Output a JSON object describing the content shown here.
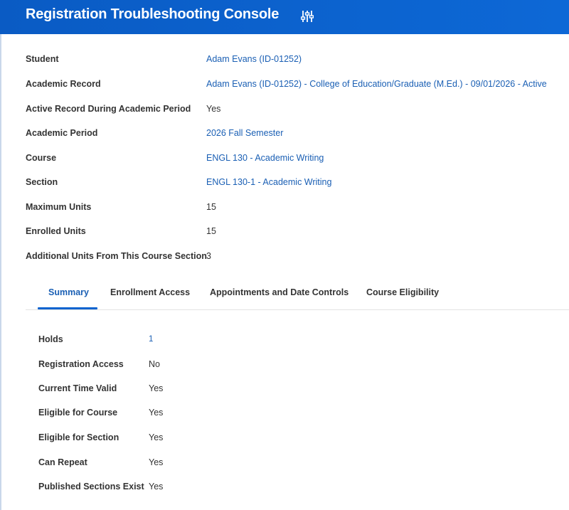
{
  "header": {
    "title": "Registration Troubleshooting Console",
    "settings_icon": "tune-sliders-icon",
    "background_color": "#0c63cf"
  },
  "details": [
    {
      "label": "Student",
      "value": "Adam Evans (ID-01252)",
      "is_link": true
    },
    {
      "label": "Academic Record",
      "value": "Adam Evans (ID-01252) - College of Education/Graduate (M.Ed.) - 09/01/2026 - Active",
      "is_link": true
    },
    {
      "label": "Active Record During Academic Period",
      "value": "Yes",
      "is_link": false
    },
    {
      "label": "Academic Period",
      "value": "2026 Fall Semester",
      "is_link": true
    },
    {
      "label": "Course",
      "value": "ENGL 130 - Academic Writing",
      "is_link": true
    },
    {
      "label": "Section",
      "value": "ENGL 130-1 - Academic Writing",
      "is_link": true
    },
    {
      "label": "Maximum Units",
      "value": "15",
      "is_link": false
    },
    {
      "label": "Enrolled Units",
      "value": "15",
      "is_link": false
    },
    {
      "label": "Additional Units From This Course Section",
      "value": "3",
      "is_link": false
    }
  ],
  "tabs": [
    {
      "label": "Summary",
      "active": true
    },
    {
      "label": "Enrollment Access",
      "active": false
    },
    {
      "label": "Appointments and Date Controls",
      "active": false
    },
    {
      "label": "Course Eligibility",
      "active": false
    }
  ],
  "summary": [
    {
      "label": "Holds",
      "value": "1",
      "is_link": true
    },
    {
      "label": "Registration Access",
      "value": "No",
      "is_link": false
    },
    {
      "label": "Current Time Valid",
      "value": "Yes",
      "is_link": false
    },
    {
      "label": "Eligible for Course",
      "value": "Yes",
      "is_link": false
    },
    {
      "label": "Eligible for Section",
      "value": "Yes",
      "is_link": false
    },
    {
      "label": "Can Repeat",
      "value": "Yes",
      "is_link": false
    },
    {
      "label": "Published Sections Exist",
      "value": "Yes",
      "is_link": false
    }
  ],
  "colors": {
    "link": "#1a5fb4",
    "active_tab_underline": "#0c63cf",
    "text": "#333333"
  }
}
